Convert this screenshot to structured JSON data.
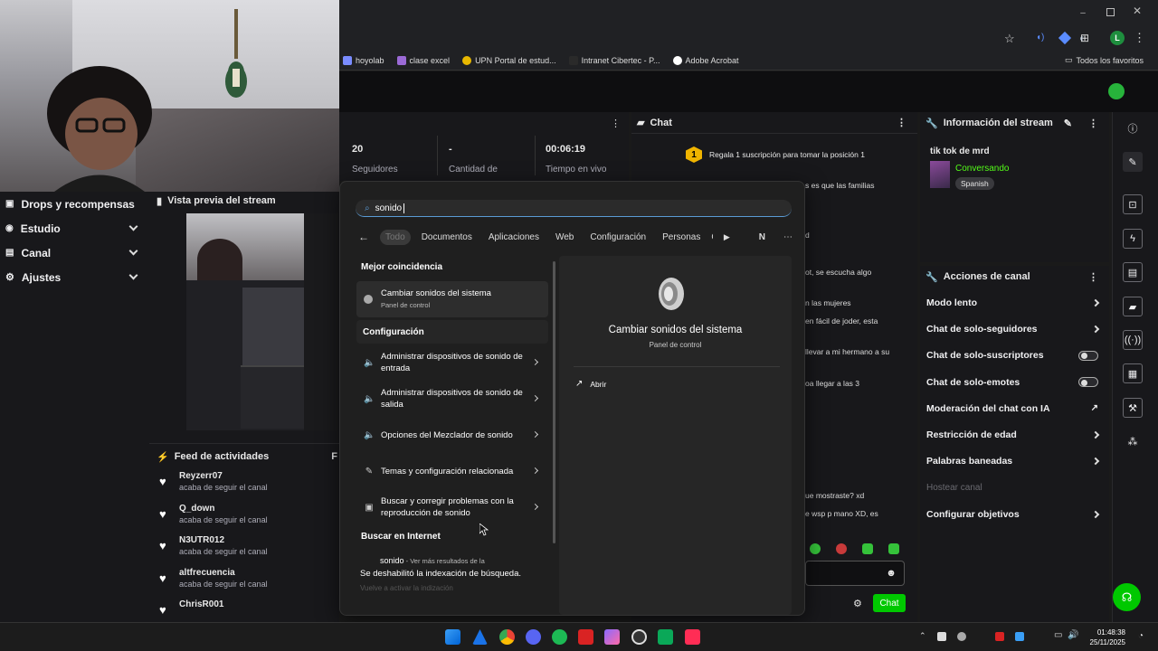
{
  "browser": {
    "bookmarks": [
      {
        "label": "hoyolab",
        "color": "#7a8cff"
      },
      {
        "label": "clase excel",
        "color": "#9b6ad6"
      },
      {
        "label": "UPN Portal de estud...",
        "color": "#e8b800"
      },
      {
        "label": "Intranet Cibertec - P...",
        "color": "#2a2a2a"
      },
      {
        "label": "Adobe Acrobat",
        "color": "#ffffff"
      }
    ],
    "favorites_label": "Todos los favoritos"
  },
  "left_nav": {
    "items": [
      {
        "label": "Drops y recompensas",
        "icon": "gift-icon",
        "expandable": false
      },
      {
        "label": "Estudio",
        "icon": "record-icon",
        "expandable": true
      },
      {
        "label": "Canal",
        "icon": "list-icon",
        "expandable": true
      },
      {
        "label": "Ajustes",
        "icon": "gear-icon",
        "expandable": true
      }
    ]
  },
  "preview": {
    "title": "Vista previa del stream"
  },
  "feed": {
    "title": "Feed de actividades",
    "items": [
      {
        "name": "Reyzerr07",
        "action": "acaba de seguir el canal"
      },
      {
        "name": "Q_down",
        "action": "acaba de seguir el canal"
      },
      {
        "name": "N3UTR012",
        "action": "acaba de seguir el canal"
      },
      {
        "name": "altfrecuencia",
        "action": "acaba de seguir el canal"
      },
      {
        "name": "ChrisR001",
        "action": ""
      }
    ]
  },
  "stats": [
    {
      "value": "20",
      "label": "Seguidores"
    },
    {
      "value": "-",
      "label": "Cantidad de"
    },
    {
      "value": "00:06:19",
      "label": "Tiempo en vivo"
    }
  ],
  "chat": {
    "title": "Chat",
    "gift_banner": "Regala 1 suscripción para tomar la posición 1",
    "gift_rank": "1",
    "visible_lines": [
      "s es que las familias",
      "d",
      "ot, se escucha algo",
      "n las mujeres",
      "en fácil de joder, esta",
      "llevar a mi hermano a su",
      "oa llegar a las 3",
      "ue mostraste? xd",
      "e wsp p mano XD, es"
    ],
    "send_label": "Chat"
  },
  "stream_info": {
    "title": "Información del stream",
    "stream_title": "tik tok de mrd",
    "category": "Conversando",
    "tag": "Spanish"
  },
  "channel_actions": {
    "title": "Acciones de canal",
    "items": [
      {
        "label": "Modo lento",
        "control": "arrow"
      },
      {
        "label": "Chat de solo-seguidores",
        "control": "arrow"
      },
      {
        "label": "Chat de solo-suscriptores",
        "control": "toggle"
      },
      {
        "label": "Chat de solo-emotes",
        "control": "toggle"
      },
      {
        "label": "Moderación del chat con IA",
        "control": "external"
      },
      {
        "label": "Restricción de edad",
        "control": "arrow"
      },
      {
        "label": "Palabras baneadas",
        "control": "arrow"
      },
      {
        "label": "Hostear canal",
        "control": "none",
        "disabled": true
      },
      {
        "label": "Configurar objetivos",
        "control": "arrow"
      }
    ]
  },
  "search": {
    "query": "sonido",
    "filters": [
      "Todo",
      "Documentos",
      "Aplicaciones",
      "Web",
      "Configuración",
      "Personas",
      "C"
    ],
    "filter_letter": "N",
    "best_match_heading": "Mejor coincidencia",
    "best_match": {
      "title": "Cambiar sonidos del sistema",
      "subtitle": "Panel de control"
    },
    "settings_heading": "Configuración",
    "settings": [
      {
        "title": "Administrar dispositivos de sonido de entrada",
        "icon": "speaker-icon"
      },
      {
        "title": "Administrar dispositivos de sonido de salida",
        "icon": "speaker-icon"
      },
      {
        "title": "Opciones del Mezclador de sonido",
        "icon": "speaker-icon"
      },
      {
        "title": "Temas y configuración relacionada",
        "icon": "brush-icon"
      },
      {
        "title": "Buscar y corregir problemas con la reproducción de sonido",
        "icon": "troubleshoot-icon"
      }
    ],
    "web_heading": "Buscar en Internet",
    "web_result": {
      "query": "sonido",
      "suffix": " - Ver más resultados de la"
    },
    "indexing_notice": "Se deshabilitó la indexación de búsqueda.",
    "indexing_link": "Vuelve a activar la indización",
    "detail": {
      "title": "Cambiar sonidos del sistema",
      "subtitle": "Panel de control",
      "open_label": "Abrir"
    }
  },
  "taskbar": {
    "time": "01:48:38",
    "date": "25/11/2025"
  }
}
